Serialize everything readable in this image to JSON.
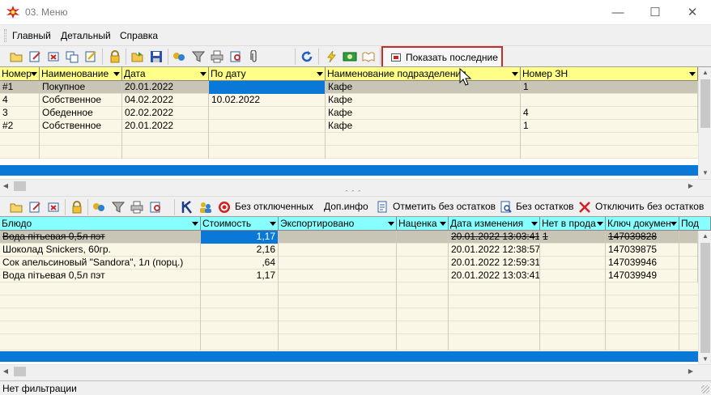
{
  "window": {
    "title": "03. Меню",
    "controls": {
      "minimize": "—",
      "maximize": "☐",
      "close": "✕"
    }
  },
  "menu": {
    "items": [
      "Главный",
      "Детальный",
      "Справка"
    ]
  },
  "toolbar_top": {
    "icons": [
      "open-folder-icon",
      "edit-icon",
      "delete-icon",
      "copy-icon",
      "edit-list-icon",
      "lock-icon",
      "folder-open-icon",
      "save-icon",
      "group-icon",
      "filter-icon",
      "print-icon",
      "print-preview-icon",
      "attach-icon",
      "refresh-icon",
      "lightning-icon",
      "money-icon",
      "book-icon"
    ],
    "show_last_label": "Показать последние"
  },
  "grid_top": {
    "columns": [
      {
        "label": "Номер"
      },
      {
        "label": "Наименование"
      },
      {
        "label": "Дата"
      },
      {
        "label": "По дату"
      },
      {
        "label": "Наименование подразделения"
      },
      {
        "label": "Номер ЗН"
      }
    ],
    "rows": [
      [
        "#1",
        "Покупное",
        "20.01.2022",
        "",
        "Кафе",
        "1"
      ],
      [
        "4",
        "Собственное",
        "04.02.2022",
        "10.02.2022",
        "Кафе",
        ""
      ],
      [
        "3",
        "Обеденное",
        "02.02.2022",
        "",
        "Кафе",
        "4"
      ],
      [
        "#2",
        "Собственное",
        "20.01.2022",
        "",
        "Кафе",
        "1"
      ]
    ]
  },
  "toolbar_bottom": {
    "without_disabled": "Без отключенных",
    "more_info": "Доп.инфо",
    "mark_no_stock": "Отметить без остатков",
    "no_stock": "Без остатков",
    "disable_no_stock": "Отключить без остатков"
  },
  "grid_bottom": {
    "columns": [
      {
        "label": "Блюдо"
      },
      {
        "label": "Стоимость"
      },
      {
        "label": "Экспортировано"
      },
      {
        "label": "Наценка"
      },
      {
        "label": "Дата изменения"
      },
      {
        "label": "Нет в прода"
      },
      {
        "label": "Ключ докумен"
      },
      {
        "label": "Под"
      }
    ],
    "rows": [
      [
        "Вода пітьевая 0,5л пэт",
        "1,17",
        "",
        "",
        "20.01.2022 13:03:41",
        "1",
        "147039828",
        ""
      ],
      [
        "Шоколад Snickers, 60гр.",
        "2,16",
        "",
        "",
        "20.01.2022 12:38:57",
        "",
        "147039875",
        ""
      ],
      [
        "Сок апельсиновый \"Sandora\", 1л (порц.)",
        ",64",
        "",
        "",
        "20.01.2022 12:59:31",
        "",
        "147039946",
        ""
      ],
      [
        "Вода пітьевая 0,5л пэт",
        "1,17",
        "",
        "",
        "20.01.2022 13:03:41",
        "",
        "147039949",
        ""
      ]
    ]
  },
  "status": {
    "text": "Нет фильтрации"
  },
  "colors": {
    "header_top": "#ffff88",
    "header_bottom": "#88ffff",
    "selection": "#0a78d6",
    "highlight_border": "#c42b2b"
  }
}
